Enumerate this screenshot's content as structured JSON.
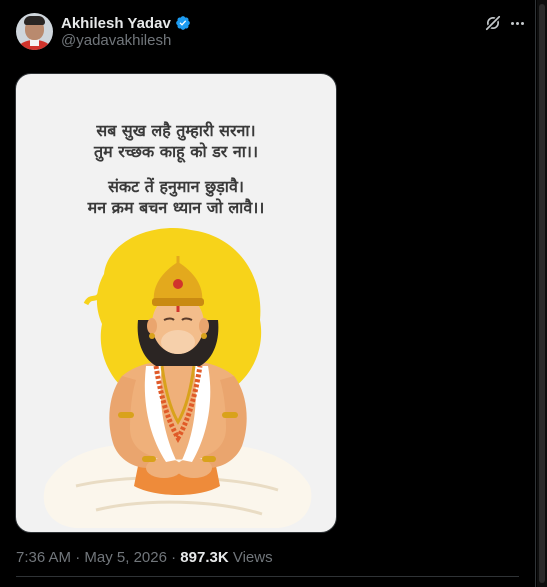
{
  "author": {
    "display_name": "Akhilesh Yadav",
    "handle": "@yadavakhilesh",
    "verified": true,
    "verified_color": "#1d9bf0"
  },
  "actions": {
    "grok_icon": "grok-icon",
    "more_icon": "more-icon"
  },
  "media": {
    "verse_lines": [
      "सब सुख लहै तुम्हारी सरना।",
      "तुम रच्छक काहू को डर ना।।",
      "संकट तें हनुमान छुड़ावै।",
      "मन क्रम बचन ध्यान जो लावै।।"
    ],
    "illustration": "hanuman-meditating-illustration",
    "halo_color": "#f7d31a"
  },
  "meta": {
    "time": "7:36 AM",
    "date": "May 5, 2026",
    "separator": "·",
    "views_count": "897.3K",
    "views_label": "Views"
  }
}
